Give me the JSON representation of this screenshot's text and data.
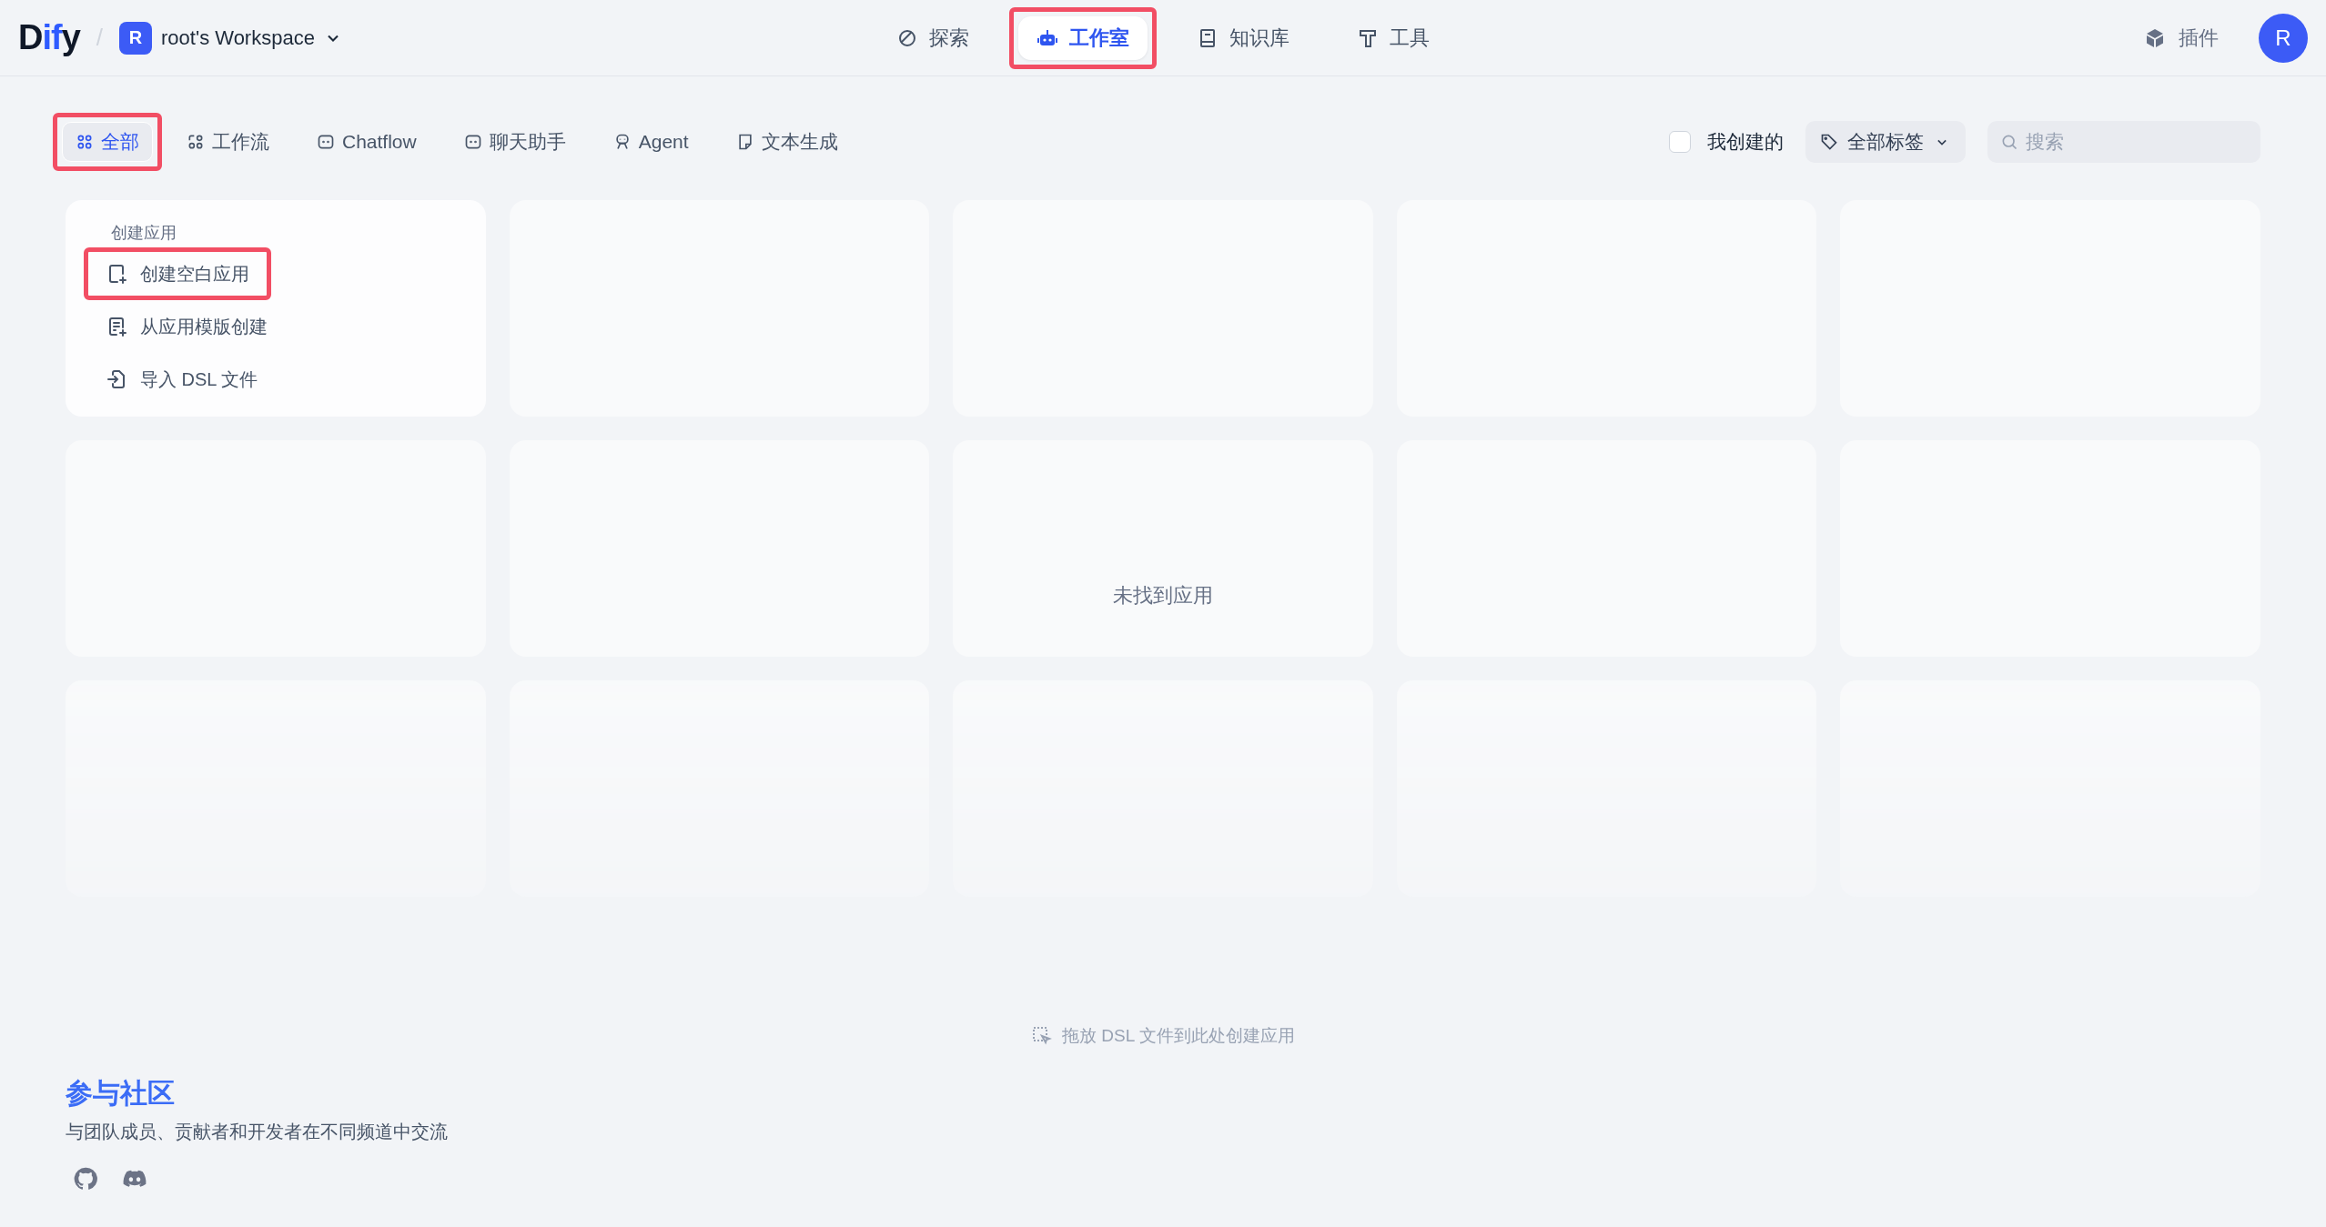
{
  "header": {
    "logo": "Dify",
    "separator": "/",
    "workspace": {
      "initial": "R",
      "name": "root's Workspace"
    },
    "nav": [
      {
        "kind": "explore",
        "label": "探索",
        "selected": false,
        "annotated": false
      },
      {
        "kind": "studio",
        "label": "工作室",
        "selected": true,
        "annotated": true
      },
      {
        "kind": "knowledge",
        "label": "知识库",
        "selected": false,
        "annotated": false
      },
      {
        "kind": "tools",
        "label": "工具",
        "selected": false,
        "annotated": false
      }
    ],
    "plugins": "插件",
    "avatar": "R"
  },
  "filters": {
    "tabs": [
      {
        "kind": "all",
        "label": "全部",
        "selected": true,
        "annotated": true
      },
      {
        "kind": "workflow",
        "label": "工作流",
        "selected": false,
        "annotated": false
      },
      {
        "kind": "chat",
        "label": "Chatflow",
        "selected": false,
        "annotated": false
      },
      {
        "kind": "chat",
        "label": "聊天助手",
        "selected": false,
        "annotated": false
      },
      {
        "kind": "agent",
        "label": "Agent",
        "selected": false,
        "annotated": false
      },
      {
        "kind": "text",
        "label": "文本生成",
        "selected": false,
        "annotated": false
      }
    ],
    "mine": {
      "label": "我创建的",
      "checked": false
    },
    "tags": "全部标签",
    "search": {
      "placeholder": "搜索"
    }
  },
  "create_card": {
    "title": "创建应用",
    "items": [
      {
        "kind": "blank",
        "label": "创建空白应用",
        "annotated": true
      },
      {
        "kind": "template",
        "label": "从应用模版创建",
        "annotated": false
      },
      {
        "kind": "import",
        "label": "导入 DSL 文件",
        "annotated": false
      }
    ]
  },
  "empty_message": "未找到应用",
  "drop_hint": "拖放 DSL 文件到此处创建应用",
  "community": {
    "title": "参与社区",
    "description": "与团队成员、贡献者和开发者在不同频道中交流"
  }
}
